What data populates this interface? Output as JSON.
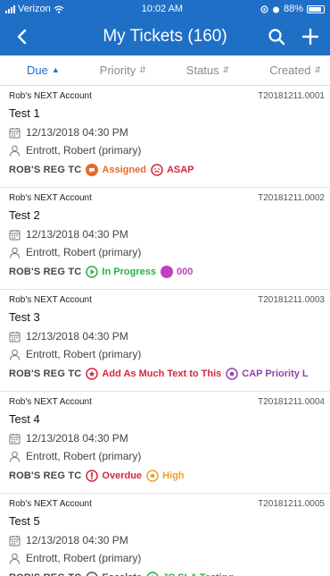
{
  "status_bar": {
    "carrier": "Verizon",
    "time": "10:02 AM",
    "battery": "88%",
    "battery_level": 0.88
  },
  "nav": {
    "title": "My Tickets (160)"
  },
  "sort": [
    {
      "label": "Due",
      "active": true
    },
    {
      "label": "Priority",
      "active": false
    },
    {
      "label": "Status",
      "active": false
    },
    {
      "label": "Created",
      "active": false
    }
  ],
  "tickets": [
    {
      "account": "Rob's NEXT Account",
      "id": "T20181211.0001",
      "title": "Test 1",
      "date": "12/13/2018 04:30 PM",
      "contact": "Entrott, Robert (primary)",
      "group": "ROB'S REG TC",
      "status": {
        "label": "Assigned",
        "color": "#e8692c",
        "icon": "chat-icon"
      },
      "priority": {
        "label": "ASAP",
        "color": "#d7263d",
        "icon": "face-icon"
      }
    },
    {
      "account": "Rob's NEXT Account",
      "id": "T20181211.0002",
      "title": "Test 2",
      "date": "12/13/2018 04:30 PM",
      "contact": "Entrott, Robert (primary)",
      "group": "ROB'S REG TC",
      "status": {
        "label": "In Progress",
        "color": "#27b04b",
        "icon": "play-icon"
      },
      "priority": {
        "label": "000",
        "color": "#c13fbd",
        "icon": "dot-icon"
      }
    },
    {
      "account": "Rob's NEXT Account",
      "id": "T20181211.0003",
      "title": "Test 3",
      "date": "12/13/2018 04:30 PM",
      "contact": "Entrott, Robert (primary)",
      "group": "ROB'S REG TC",
      "status": {
        "label": "Add As Much Text to This",
        "color": "#d7263d",
        "icon": "star-icon"
      },
      "priority": {
        "label": "CAP Priority L",
        "color": "#8e44ad",
        "icon": "target-icon"
      }
    },
    {
      "account": "Rob's NEXT Account",
      "id": "T20181211.0004",
      "title": "Test 4",
      "date": "12/13/2018 04:30 PM",
      "contact": "Entrott, Robert (primary)",
      "group": "ROB'S REG TC",
      "status": {
        "label": "Overdue",
        "color": "#d7263d",
        "icon": "exclamation-icon"
      },
      "priority": {
        "label": "High",
        "color": "#f0a020",
        "icon": "target-icon"
      }
    },
    {
      "account": "Rob's NEXT Account",
      "id": "T20181211.0005",
      "title": "Test 5",
      "date": "12/13/2018 04:30 PM",
      "contact": "Entrott, Robert (primary)",
      "group": "ROB'S REG TC",
      "status": {
        "label": "Escalate",
        "color": "#555555",
        "icon": "target-icon"
      },
      "priority": {
        "label": "JC SLA Testing",
        "color": "#27b04b",
        "icon": "bolt-icon"
      }
    }
  ]
}
